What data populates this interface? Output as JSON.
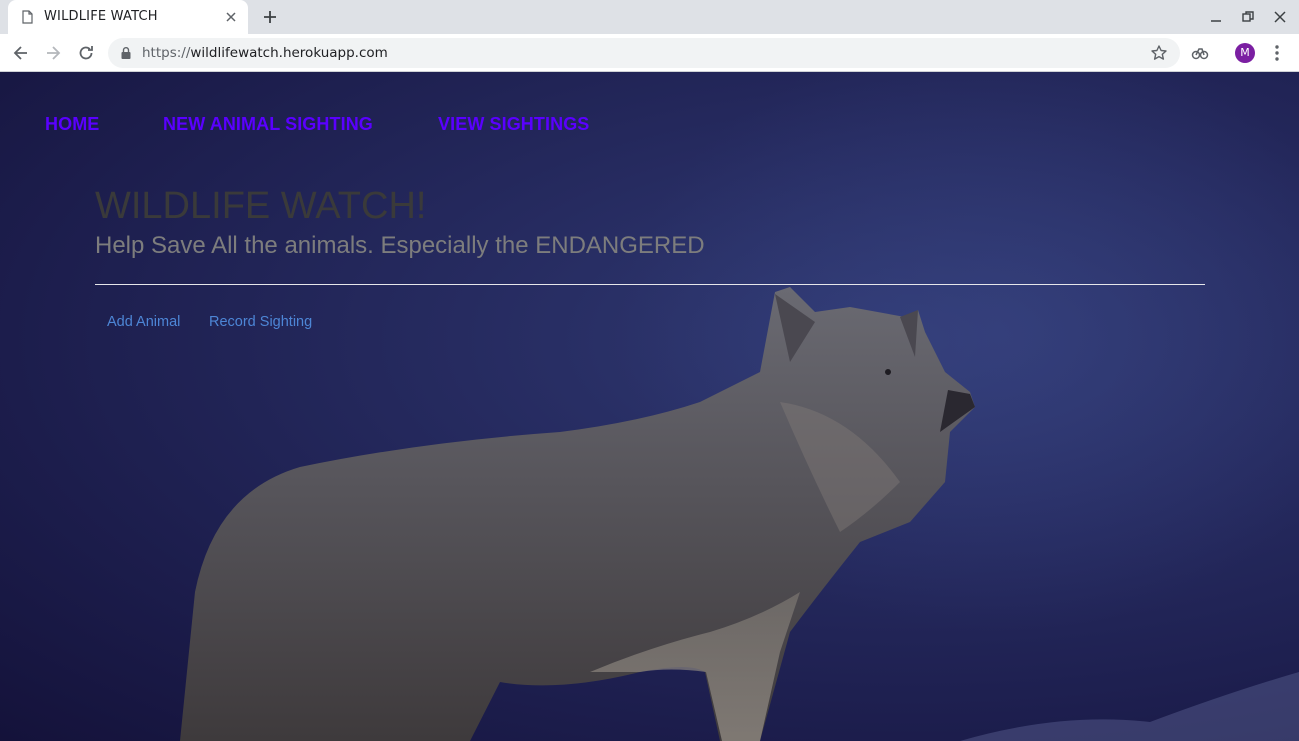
{
  "browser": {
    "tab_title": "WILDLIFE WATCH",
    "url_host": "wildlifewatch.herokuapp.com",
    "url_scheme": "https://",
    "profile_initial": "M"
  },
  "nav": {
    "home": "HOME",
    "new_sighting": "NEW ANIMAL SIGHTING",
    "view_sightings": "VIEW SIGHTINGS"
  },
  "hero": {
    "title": "WILDLIFE WATCH!",
    "subtitle": "Help Save All the animals. Especially the ENDANGERED"
  },
  "actions": {
    "add_animal": "Add Animal",
    "record_sighting": "Record Sighting"
  },
  "colors": {
    "nav_link": "#5a00ff",
    "action_link": "#4d86d6",
    "background": "#1b1d45"
  }
}
